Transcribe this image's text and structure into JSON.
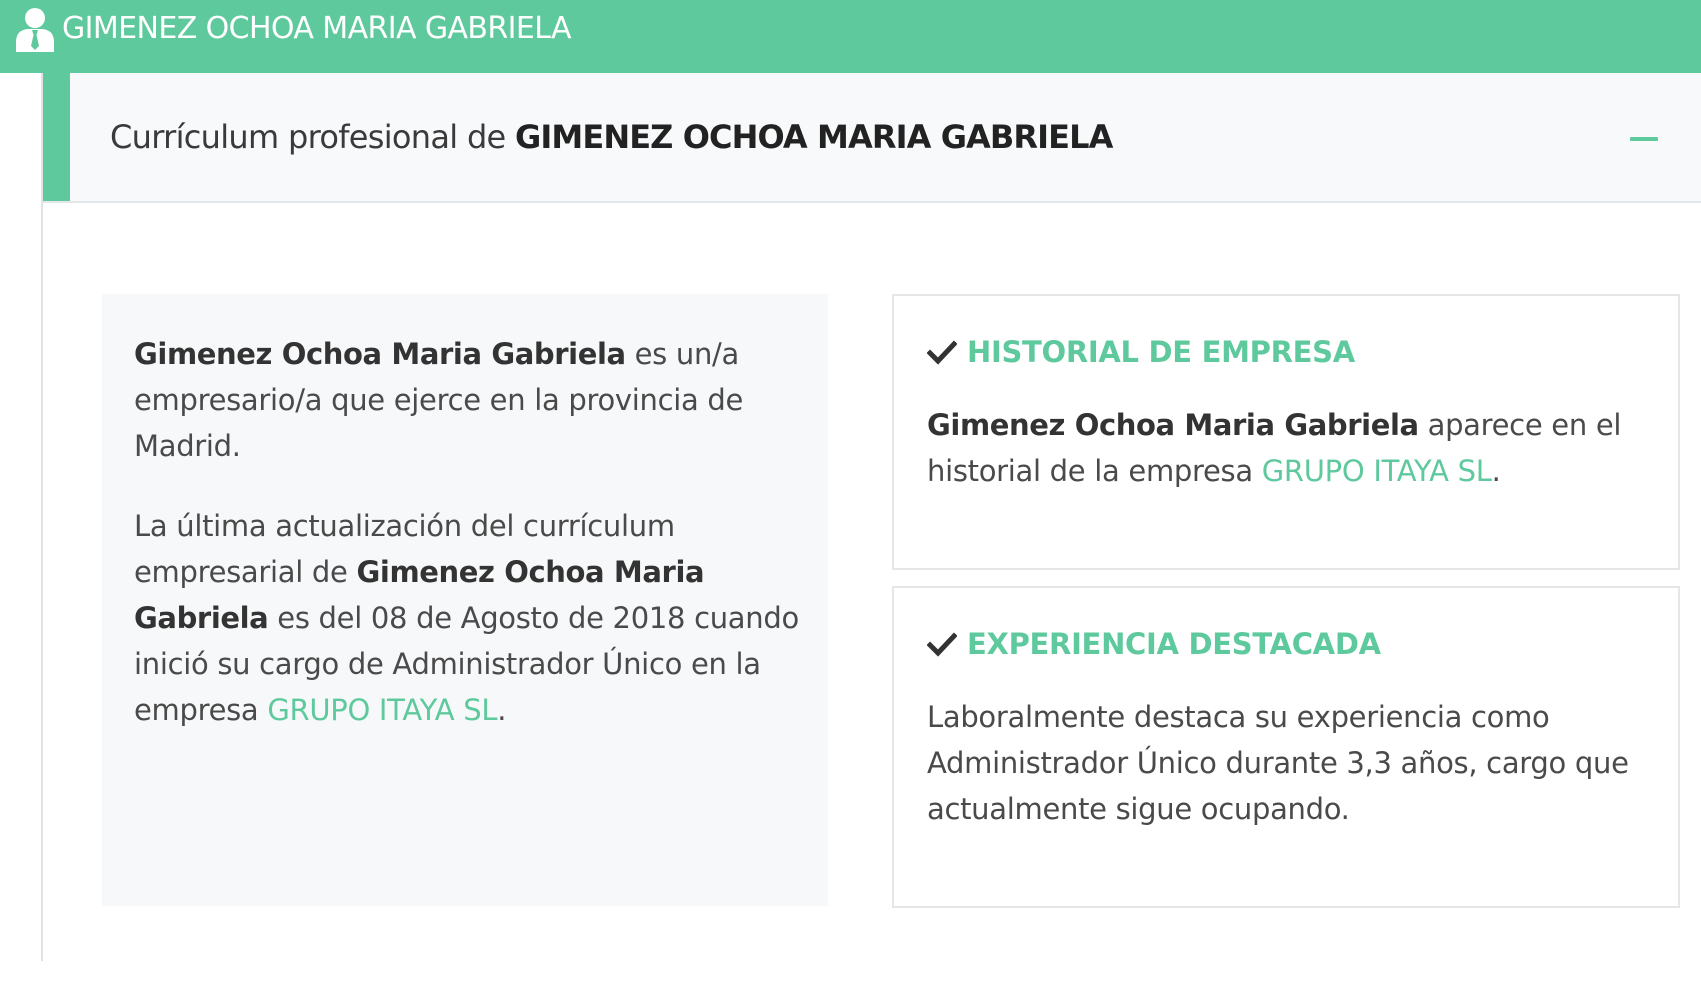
{
  "topbar": {
    "title": "GIMENEZ OCHOA MARIA GABRIELA",
    "icon": "user-icon"
  },
  "header": {
    "prefix": "Currículum profesional de",
    "name": "GIMENEZ OCHOA MARIA GABRIELA",
    "collapse_icon": "minus-icon"
  },
  "summary": {
    "p1": {
      "name": "Gimenez Ochoa Maria Gabriela",
      "text": " es un/a empresario/a que ejerce en la provincia de Madrid."
    },
    "p2": {
      "text_a": "La última actualización del currículum empresarial de ",
      "name": "Gimenez Ochoa Maria Gabriela",
      "text_b": " es del 08 de Agosto de 2018 cuando inició su cargo de Administrador Único en la empresa ",
      "company": "GRUPO ITAYA SL",
      "text_c": "."
    }
  },
  "history_card": {
    "title": "HISTORIAL DE EMPRESA",
    "name": "Gimenez Ochoa Maria Gabriela",
    "text_a": " aparece en el historial de la empresa ",
    "company": "GRUPO ITAYA SL",
    "text_b": "."
  },
  "experience_card": {
    "title": "EXPERIENCIA DESTACADA",
    "text": "Laboralmente destaca su experiencia como Administrador Único durante 3,3 años, cargo que actualmente sigue ocupando."
  },
  "colors": {
    "accent": "#5fc99e",
    "header_bg": "#f8f9fa",
    "summary_bg": "#f7f8f9",
    "text": "#4a4a4a"
  }
}
